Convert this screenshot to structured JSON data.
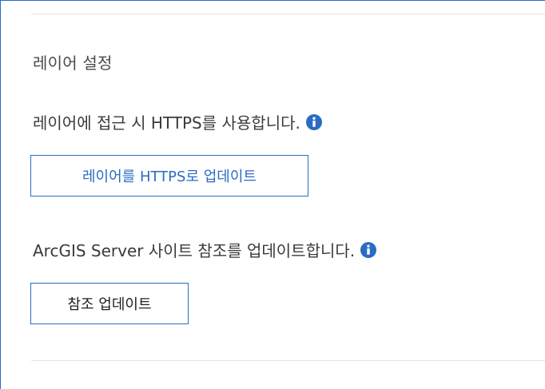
{
  "panel": {
    "section_title": "레이어 설정",
    "https_description": "레이어에 접근 시 HTTPS를 사용합니다.",
    "https_button_label": "레이어를 HTTPS로 업데이트",
    "refs_description": "ArcGIS Server 사이트 참조를 업데이트합니다.",
    "refs_button_label": "참조 업데이트"
  },
  "icons": {
    "info": "info-circle-icon"
  },
  "colors": {
    "accent": "#2a6cc4",
    "text": "#3a3a3a",
    "divider": "#e4e4e4"
  }
}
